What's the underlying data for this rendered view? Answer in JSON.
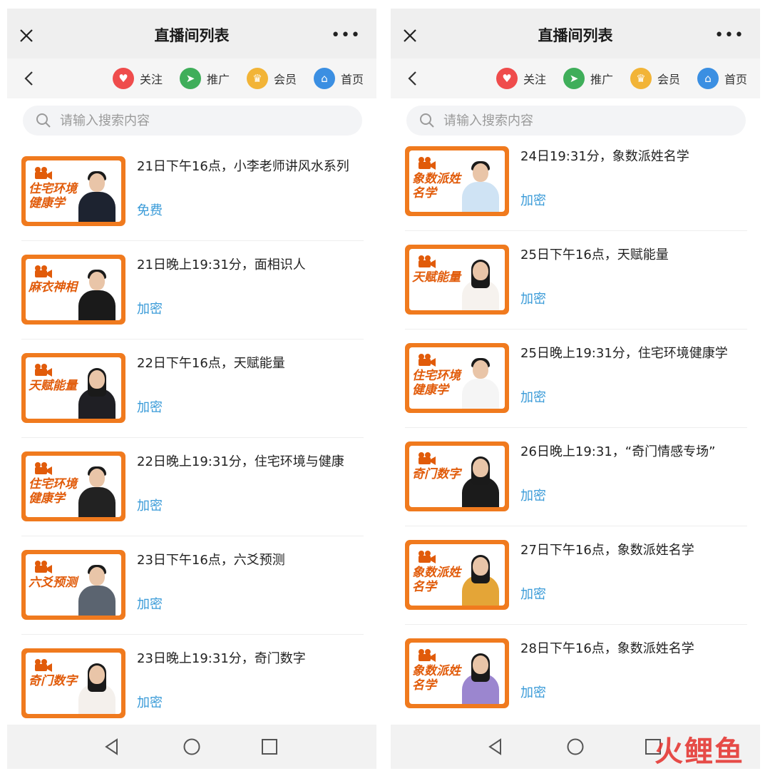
{
  "screens": [
    {
      "title": "直播间列表",
      "more": "•••",
      "nav": [
        {
          "label": "关注",
          "icon": "heart-icon",
          "color": "#ef4c4c",
          "glyph": "♥"
        },
        {
          "label": "推广",
          "icon": "send-icon",
          "color": "#3fae5a",
          "glyph": "➤"
        },
        {
          "label": "会员",
          "icon": "crown-icon",
          "color": "#f2b437",
          "glyph": "♛"
        },
        {
          "label": "首页",
          "icon": "home-icon",
          "color": "#3b8fe2",
          "glyph": "⌂"
        }
      ],
      "search_placeholder": "请输入搜索内容",
      "items": [
        {
          "title": "21日下午16点，小李老师讲风水系列",
          "tag": "免费",
          "thumb": "住宅环境健康学",
          "outfit": "#1d2330",
          "hair": "short"
        },
        {
          "title": "21日晚上19:31分，面相识人",
          "tag": "加密",
          "thumb": "麻衣神相",
          "outfit": "#1a1a1a",
          "hair": "short"
        },
        {
          "title": "22日下午16点，天赋能量",
          "tag": "加密",
          "thumb": "天赋能量",
          "outfit": "#1f1f24",
          "hair": "long"
        },
        {
          "title": "22日晚上19:31分，住宅环境与健康",
          "tag": "加密",
          "thumb": "住宅环境健康学",
          "outfit": "#222222",
          "hair": "short"
        },
        {
          "title": "23日下午16点，六爻预测",
          "tag": "加密",
          "thumb": "六爻预测",
          "outfit": "#5b6470",
          "hair": "short"
        },
        {
          "title": "23日晚上19:31分，奇门数字",
          "tag": "加密",
          "thumb": "奇门数字",
          "outfit": "#f4f0ec",
          "hair": "long"
        }
      ]
    },
    {
      "title": "直播间列表",
      "more": "•••",
      "nav": [
        {
          "label": "关注",
          "icon": "heart-icon",
          "color": "#ef4c4c",
          "glyph": "♥"
        },
        {
          "label": "推广",
          "icon": "send-icon",
          "color": "#3fae5a",
          "glyph": "➤"
        },
        {
          "label": "会员",
          "icon": "crown-icon",
          "color": "#f2b437",
          "glyph": "♛"
        },
        {
          "label": "首页",
          "icon": "home-icon",
          "color": "#3b8fe2",
          "glyph": "⌂"
        }
      ],
      "search_placeholder": "请输入搜索内容",
      "items": [
        {
          "title": "24日19:31分，象数派姓名学",
          "tag": "加密",
          "thumb": "象数派姓名学",
          "outfit": "#cfe3f4",
          "hair": "short"
        },
        {
          "title": "25日下午16点，天赋能量",
          "tag": "加密",
          "thumb": "天赋能量",
          "outfit": "#f6f2ee",
          "hair": "long"
        },
        {
          "title": "25日晚上19:31分，住宅环境健康学",
          "tag": "加密",
          "thumb": "住宅环境健康学",
          "outfit": "#f5f5f5",
          "hair": "short"
        },
        {
          "title": "26日晚上19:31，“奇门情感专场”",
          "tag": "加密",
          "thumb": "奇门数字",
          "outfit": "#1b1b1b",
          "hair": "long"
        },
        {
          "title": "27日下午16点，象数派姓名学",
          "tag": "加密",
          "thumb": "象数派姓名学",
          "outfit": "#e4a537",
          "hair": "long"
        },
        {
          "title": "28日下午16点，象数派姓名学",
          "tag": "加密",
          "thumb": "象数派姓名学",
          "outfit": "#9b86cf",
          "hair": "long"
        }
      ]
    }
  ],
  "watermark": "火鲤鱼"
}
